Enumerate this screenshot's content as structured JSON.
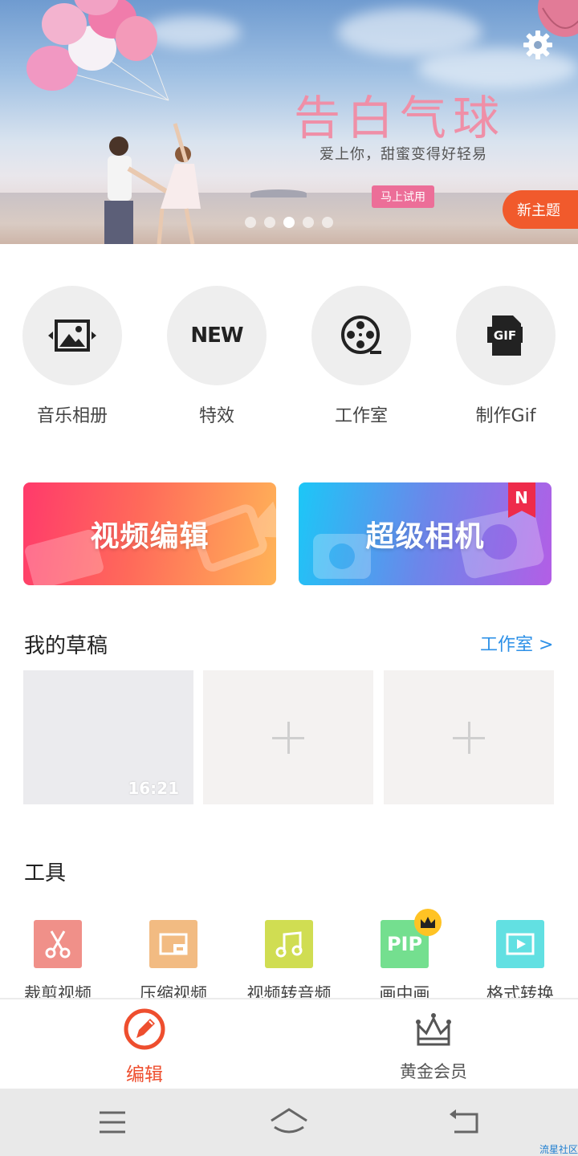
{
  "banner": {
    "title": "告白气球",
    "subtitle": "爱上你，甜蜜变得好轻易",
    "try_button": "马上试用",
    "new_theme_button": "新主题",
    "dots_count": 5,
    "active_dot": 2
  },
  "quick_actions": [
    {
      "label": "音乐相册",
      "icon": "photo-album-icon"
    },
    {
      "label": "特效",
      "icon": "new-text-icon",
      "icon_text": "NEW"
    },
    {
      "label": "工作室",
      "icon": "film-reel-icon"
    },
    {
      "label": "制作Gif",
      "icon": "gif-file-icon",
      "icon_text": "GIF"
    }
  ],
  "cards": {
    "video_edit": "视频编辑",
    "super_camera": "超级相机",
    "new_badge": "N"
  },
  "drafts": {
    "title": "我的草稿",
    "studio_link": "工作室 >",
    "items": [
      {
        "duration": "16:21",
        "filled": true
      },
      {
        "filled": false
      },
      {
        "filled": false
      }
    ]
  },
  "tools": {
    "title": "工具",
    "items": [
      {
        "label": "裁剪视频",
        "icon": "scissors-icon",
        "color": "#f09089"
      },
      {
        "label": "压缩视频",
        "icon": "compress-icon",
        "color": "#f2bb82"
      },
      {
        "label": "视频转音频",
        "icon": "music-note-icon",
        "color": "#d0dd52"
      },
      {
        "label": "画中画",
        "icon": "pip-icon",
        "icon_text": "PIP",
        "color": "#74df8f",
        "premium": true
      },
      {
        "label": "格式转换",
        "icon": "format-convert-icon",
        "color": "#62e0e2"
      }
    ]
  },
  "tabbar": {
    "edit_label": "编辑",
    "vip_label": "黄金会员",
    "active_color": "#ee4e2e"
  },
  "watermark": "流星社区"
}
